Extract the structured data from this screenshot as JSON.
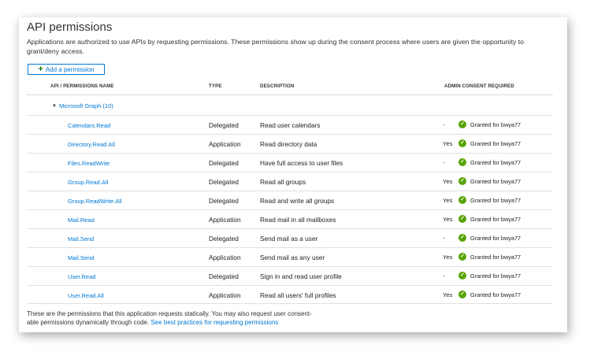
{
  "page": {
    "title": "API permissions",
    "intro": "Applications are authorized to use APIs by requesting permissions. These permissions show up during the consent process where users are given the opportunity to grant/deny access.",
    "add_button_label": "Add a permission"
  },
  "table": {
    "headers": {
      "name": "API / PERMISSIONS NAME",
      "type": "TYPE",
      "description": "DESCRIPTION",
      "admin": "ADMIN CONSENT REQUIRED"
    },
    "group_label": "Microsoft Graph (10)",
    "rows": [
      {
        "name": "Calendars.Read",
        "type": "Delegated",
        "description": "Read user calendars",
        "admin": "-",
        "status": "Granted for bwya77"
      },
      {
        "name": "Directory.Read.All",
        "type": "Application",
        "description": "Read directory data",
        "admin": "Yes",
        "status": "Granted for bwya77"
      },
      {
        "name": "Files.ReadWrite",
        "type": "Delegated",
        "description": "Have full access to user files",
        "admin": "-",
        "status": "Granted for bwya77"
      },
      {
        "name": "Group.Read.All",
        "type": "Delegated",
        "description": "Read all groups",
        "admin": "Yes",
        "status": "Granted for bwya77"
      },
      {
        "name": "Group.ReadWrite.All",
        "type": "Delegated",
        "description": "Read and write all groups",
        "admin": "Yes",
        "status": "Granted for bwya77"
      },
      {
        "name": "Mail.Read",
        "type": "Application",
        "description": "Read mail in all mailboxes",
        "admin": "Yes",
        "status": "Granted for bwya77"
      },
      {
        "name": "Mail.Send",
        "type": "Delegated",
        "description": "Send mail as a user",
        "admin": "-",
        "status": "Granted for bwya77"
      },
      {
        "name": "Mail.Send",
        "type": "Application",
        "description": "Send mail as any user",
        "admin": "Yes",
        "status": "Granted for bwya77"
      },
      {
        "name": "User.Read",
        "type": "Delegated",
        "description": "Sign in and read user profile",
        "admin": "-",
        "status": "Granted for bwya77"
      },
      {
        "name": "User.Read.All",
        "type": "Application",
        "description": "Read all users' full profiles",
        "admin": "Yes",
        "status": "Granted for bwya77"
      }
    ]
  },
  "footer": {
    "text_line1": "These are the permissions that this application requests statically. You may also request user consent-",
    "text_line2": "able permissions dynamically through code.",
    "link": "See best practices for requesting permissions"
  },
  "icons": {
    "add": "plus-icon",
    "expand": "caret-down-icon",
    "granted": "check-circle-icon"
  },
  "colors": {
    "accent": "#0078d4",
    "granted": "#57a300",
    "add_plus": "#107c10"
  }
}
